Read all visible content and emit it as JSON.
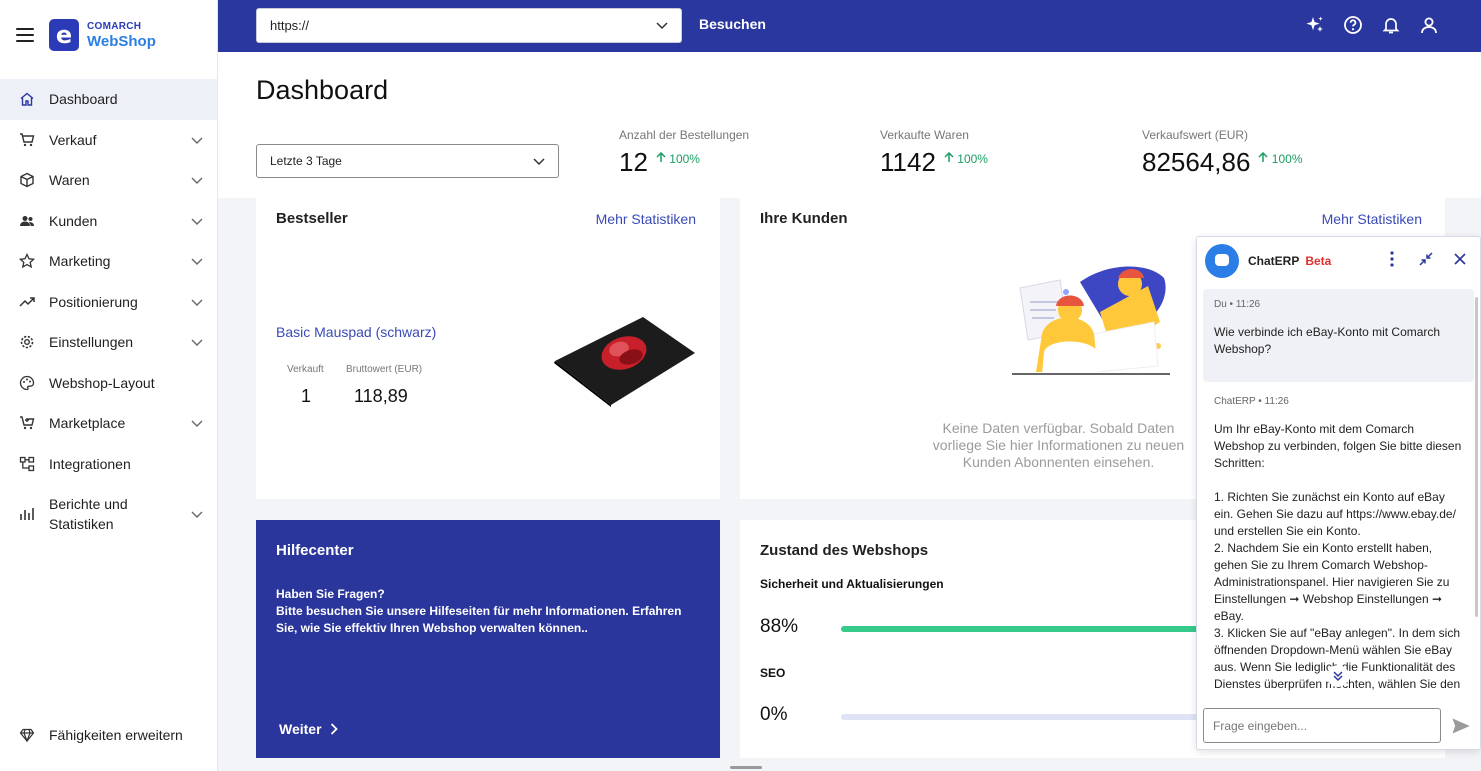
{
  "brand": {
    "company": "COMARCH",
    "product": "WebShop",
    "mark": "e"
  },
  "sidebar": {
    "items": [
      {
        "label": "Dashboard",
        "icon": "home-icon",
        "active": true,
        "expandable": false
      },
      {
        "label": "Verkauf",
        "icon": "cart-icon",
        "expandable": true
      },
      {
        "label": "Waren",
        "icon": "box-icon",
        "expandable": true
      },
      {
        "label": "Kunden",
        "icon": "users-icon",
        "expandable": true
      },
      {
        "label": "Marketing",
        "icon": "star-icon",
        "expandable": true
      },
      {
        "label": "Positionierung",
        "icon": "trend-icon",
        "expandable": true
      },
      {
        "label": "Einstellungen",
        "icon": "gear-icon",
        "expandable": true
      },
      {
        "label": "Webshop-Layout",
        "icon": "palette-icon",
        "expandable": false
      },
      {
        "label": "Marketplace",
        "icon": "cart-plus-icon",
        "expandable": true
      },
      {
        "label": "Integrationen",
        "icon": "integration-icon",
        "expandable": false
      },
      {
        "label": "Berichte und Statistiken",
        "icon": "chart-icon",
        "expandable": true
      }
    ],
    "bottom_item": {
      "label": "Fähigkeiten erweitern",
      "icon": "diamond-icon"
    }
  },
  "topbar": {
    "url_value": "https://",
    "visit_label": "Besuchen",
    "icons": [
      "sparkle-icon",
      "help-icon",
      "bell-icon",
      "user-icon"
    ]
  },
  "header": {
    "title": "Dashboard",
    "range_value": "Letzte 3 Tage",
    "kpis": [
      {
        "label": "Anzahl der Bestellungen",
        "value": "12",
        "change": "100%"
      },
      {
        "label": "Verkaufte Waren",
        "value": "1142",
        "change": "100%"
      },
      {
        "label": "Verkaufswert (EUR)",
        "value": "82564,86",
        "change": "100%"
      }
    ]
  },
  "bestseller": {
    "title": "Bestseller",
    "link": "Mehr Statistiken",
    "product": "Basic Mauspad (schwarz)",
    "sold_label": "Verkauft",
    "sold_value": "1",
    "gross_label": "Bruttowert (EUR)",
    "gross_value": "118,89"
  },
  "customers": {
    "title": "Ihre Kunden",
    "link": "Mehr Statistiken",
    "empty_text": "Keine Daten verfügbar. Sobald Daten vorliege Sie hier Informationen zu neuen Kunden Abonnenten einsehen."
  },
  "help": {
    "title": "Hilfecenter",
    "question": "Haben Sie Fragen?",
    "text": "Bitte besuchen Sie unsere Hilfeseiten für mehr Informationen. Erfahren Sie, wie Sie effektiv Ihren Webshop verwalten können..",
    "more": "Weiter"
  },
  "status": {
    "title": "Zustand des Webshops",
    "metrics": [
      {
        "label": "Sicherheit und Aktualisierungen",
        "value": "88%",
        "fraction": 0.88
      },
      {
        "label": "SEO",
        "value": "0%",
        "fraction": 0
      }
    ]
  },
  "chat": {
    "name": "ChatERP",
    "beta": "Beta",
    "user_meta": "Du • 11:26",
    "user_text": "Wie verbinde ich eBay-Konto mit Comarch Webshop?",
    "bot_meta": "ChatERP • 11:26",
    "bot_text": "Um Ihr eBay-Konto mit dem Comarch Webshop zu verbinden, folgen Sie bitte diesen Schritten:\n\n1. Richten Sie zunächst ein Konto auf eBay ein. Gehen Sie dazu auf https://www.ebay.de/ und erstellen Sie ein Konto.\n2. Nachdem Sie ein Konto erstellt haben, gehen Sie zu Ihrem Comarch Webshop-Administrationspanel. Hier navigieren Sie zu Einstellungen ➞ Webshop Einstellungen ➞ eBay.\n3. Klicken Sie auf \"eBay anlegen\". In dem sich öffnenden Dropdown-Menü wählen Sie eBay aus. Wenn Sie lediglich die Funktionalität des Dienstes überprüfen möchten, wählen Sie den",
    "input_placeholder": "Frage eingeben...",
    "accent": "#2a7ee6"
  },
  "colors": {
    "primary": "#2a379f",
    "link": "#3a4ab8",
    "positive": "#1a9d62",
    "progress": "#35c98a",
    "beta": "#e03030"
  }
}
